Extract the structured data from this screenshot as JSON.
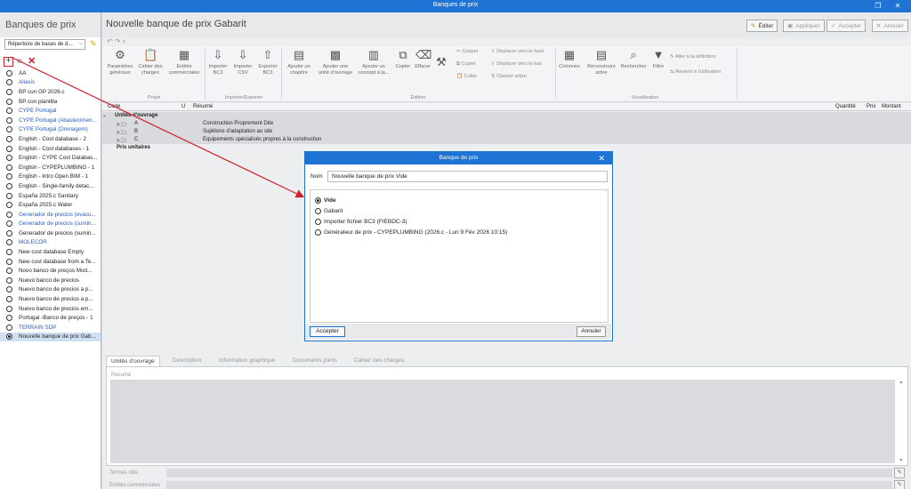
{
  "window": {
    "title": "Banques de prix"
  },
  "left": {
    "title": "Banques de prix",
    "repository": "Répertoire de bases de d...",
    "items": [
      {
        "label": "AA",
        "blue": false
      },
      {
        "label": "Aliaxis",
        "blue": true
      },
      {
        "label": "BP con GP 2026.c",
        "blue": false
      },
      {
        "label": "BP con plantilla",
        "blue": false
      },
      {
        "label": "CYPE Portugal",
        "blue": true
      },
      {
        "label": "CYPE Portugal (Abastecimen...",
        "blue": true
      },
      {
        "label": "CYPE Portugal (Drenagem)",
        "blue": true
      },
      {
        "label": "English - Cost database - 2",
        "blue": false
      },
      {
        "label": "English - Cost databases - 1",
        "blue": false
      },
      {
        "label": "English - CYPE Cost Databas...",
        "blue": false
      },
      {
        "label": "English - CYPEPLUMBING - 1",
        "blue": false
      },
      {
        "label": "English - Intro Open BIM - 1",
        "blue": false
      },
      {
        "label": "English - Single-family detac...",
        "blue": false
      },
      {
        "label": "España 2025.c Sanitary",
        "blue": false
      },
      {
        "label": "España 2025.c Water",
        "blue": false
      },
      {
        "label": "Generador de precios (evacu...",
        "blue": true
      },
      {
        "label": "Generador de precios (sumin...",
        "blue": true
      },
      {
        "label": "Generador de precios (sumin...",
        "blue": false
      },
      {
        "label": "MOLECOR",
        "blue": true
      },
      {
        "label": "New cost database Empty",
        "blue": false
      },
      {
        "label": "New cost database from a Te...",
        "blue": false
      },
      {
        "label": "Novo banco de preços Mod...",
        "blue": false
      },
      {
        "label": "Nuevo banco de precios",
        "blue": false
      },
      {
        "label": "Nuevo banco de precios a p...",
        "blue": false
      },
      {
        "label": "Nuevo banco de precios a p...",
        "blue": false
      },
      {
        "label": "Nuevo banco de precios em...",
        "blue": false
      },
      {
        "label": "Portugal -Banco de preços - 1",
        "blue": false
      },
      {
        "label": "TERRAIN SDP",
        "blue": true
      },
      {
        "label": "Nouvelle banque de prix Gab...",
        "blue": false,
        "selected": true
      }
    ]
  },
  "main": {
    "title": "Nouvelle banque de prix Gabarit",
    "buttons": {
      "edit": "Éditer",
      "apply": "Appliquer",
      "accept": "Accepter",
      "cancel": "Annuler"
    }
  },
  "ribbon": {
    "parametres": "Paramètres\ngénéraux",
    "cahier": "Cahier des\ncharges",
    "entites": "Entités\ncommerciales",
    "importer_bc3": "Importer\nBC3",
    "importer_csv": "Importer\nCSV",
    "exporter_bc3": "Exporter\nBC3",
    "ajouter_chapitre": "Ajouter un\nchapitre",
    "ajouter_unite": "Ajouter une\nunité d'ouvrage",
    "ajouter_concept": "Ajouter un\nconcept à la...",
    "copier": "Copier",
    "effacer": "Effacer",
    "couper": "Couper",
    "copier_sm": "Copier",
    "coller": "Coller",
    "deplacer_haut": "Déplacer vers le haut",
    "deplacer_bas": "Déplacer vers le bas",
    "classer": "Classer arbre",
    "colonnes": "Colonnes",
    "reconstruire": "Reconstruire\narbre",
    "rechercher": "Rechercher",
    "filtre": "Filtre",
    "aller_def": "Aller à la définition",
    "revenir": "Revenir à l'utilisation",
    "grp_projet": "Projet",
    "grp_import": "Importer/Exporter",
    "grp_edition": "Édition",
    "grp_visu": "Visualisation"
  },
  "table": {
    "headers": {
      "code": "Code",
      "u": "U",
      "resume": "Résumé",
      "quantite": "Quantité",
      "prix": "Prix",
      "montant": "Montant"
    },
    "rows": [
      {
        "code": "Unités d'ouvrage",
        "resume": "",
        "kind": "root"
      },
      {
        "code": "A",
        "resume": "Construction Proprement Dite",
        "kind": "chapter"
      },
      {
        "code": "B",
        "resume": "Sujétions d'adaptation au site",
        "kind": "chapter"
      },
      {
        "code": "C",
        "resume": "Equipements spécialisés propres à la construction",
        "kind": "chapter"
      },
      {
        "code": "Prix unitaires",
        "resume": "",
        "kind": "root"
      }
    ]
  },
  "bottom": {
    "tabs": [
      "Unités d'ouvrage",
      "Description",
      "Information graphique",
      "Documents joints",
      "Cahier des charges"
    ],
    "resume_label": "Résumé",
    "termes": "Termes clés",
    "entites": "Entités commerciales"
  },
  "dialog": {
    "title": "Banque de prix",
    "nom_label": "Nom",
    "nom_value": "Nouvelle banque de prix Vide",
    "options": [
      "Vide",
      "Gabarit",
      "Importer fichier BC3 (FIEBDC-3)",
      "Générateur de prix - CYPEPLUMBING (2026.c - Lun  9 Fév 2026  10:15)"
    ],
    "accept": "Accepter",
    "cancel": "Annuler"
  },
  "colors": {
    "titlebar": "#1e73d4",
    "annotation": "#d0202a"
  }
}
